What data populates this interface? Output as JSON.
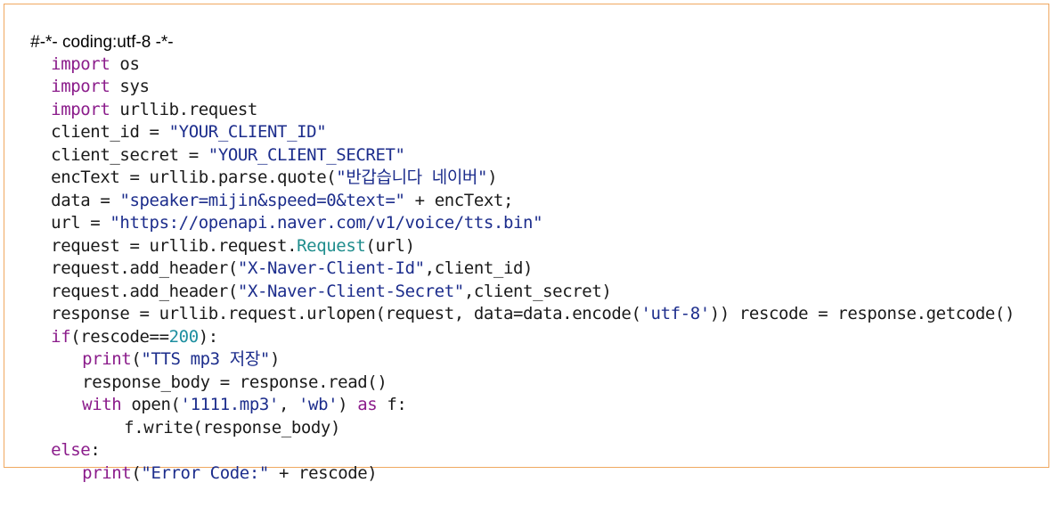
{
  "code": {
    "lines": [
      {
        "spans": [
          {
            "t": "#-*- coding:utf-8 -*-",
            "k": "pl"
          }
        ]
      },
      {
        "spans": [
          {
            "t": "import",
            "k": "kw"
          },
          {
            "t": " os",
            "k": "pl"
          }
        ]
      },
      {
        "spans": [
          {
            "t": "import",
            "k": "kw"
          },
          {
            "t": " sys",
            "k": "pl"
          }
        ]
      },
      {
        "spans": [
          {
            "t": "import",
            "k": "kw"
          },
          {
            "t": " urllib.request",
            "k": "pl"
          }
        ]
      },
      {
        "spans": [
          {
            "t": "client_id = ",
            "k": "pl"
          },
          {
            "t": "\"YOUR_CLIENT_ID\"",
            "k": "str"
          }
        ]
      },
      {
        "spans": [
          {
            "t": "client_secret = ",
            "k": "pl"
          },
          {
            "t": "\"YOUR_CLIENT_SECRET\"",
            "k": "str"
          }
        ]
      },
      {
        "spans": [
          {
            "t": "encText = urllib.parse.quote(",
            "k": "pl"
          },
          {
            "t": "\"반갑습니다 네이버\"",
            "k": "str"
          },
          {
            "t": ")",
            "k": "pl"
          }
        ]
      },
      {
        "spans": [
          {
            "t": "data = ",
            "k": "pl"
          },
          {
            "t": "\"speaker=mijin&speed=0&text=\"",
            "k": "str"
          },
          {
            "t": " + encText;",
            "k": "pl"
          }
        ]
      },
      {
        "spans": [
          {
            "t": "url = ",
            "k": "pl"
          },
          {
            "t": "\"https://openapi.naver.com/v1/voice/tts.bin\"",
            "k": "str"
          }
        ]
      },
      {
        "spans": [
          {
            "t": "request = urllib.request.",
            "k": "pl"
          },
          {
            "t": "Request",
            "k": "cls"
          },
          {
            "t": "(url)",
            "k": "pl"
          }
        ]
      },
      {
        "spans": [
          {
            "t": "request.add_header(",
            "k": "pl"
          },
          {
            "t": "\"X-Naver-Client-Id\"",
            "k": "str"
          },
          {
            "t": ",client_id)",
            "k": "pl"
          }
        ]
      },
      {
        "spans": [
          {
            "t": "request.add_header(",
            "k": "pl"
          },
          {
            "t": "\"X-Naver-Client-Secret\"",
            "k": "str"
          },
          {
            "t": ",client_secret)",
            "k": "pl"
          }
        ]
      },
      {
        "spans": [
          {
            "t": "response = urllib.request.urlopen(request, data=data.encode(",
            "k": "pl"
          },
          {
            "t": "'utf-8'",
            "k": "str"
          },
          {
            "t": ")) rescode = response.getcode()",
            "k": "pl"
          }
        ]
      },
      {
        "spans": [
          {
            "t": "if",
            "k": "kw"
          },
          {
            "t": "(rescode==",
            "k": "pl"
          },
          {
            "t": "200",
            "k": "num"
          },
          {
            "t": "):",
            "k": "pl"
          }
        ]
      },
      {
        "spans": [
          {
            "t": "print",
            "k": "kw"
          },
          {
            "t": "(",
            "k": "pl"
          },
          {
            "t": "\"TTS mp3 저장\"",
            "k": "str"
          },
          {
            "t": ")",
            "k": "pl"
          }
        ]
      },
      {
        "spans": [
          {
            "t": "response_body = response.read()",
            "k": "pl"
          }
        ]
      },
      {
        "spans": [
          {
            "t": "with",
            "k": "kw"
          },
          {
            "t": " open(",
            "k": "pl"
          },
          {
            "t": "'1111.mp3'",
            "k": "str"
          },
          {
            "t": ", ",
            "k": "pl"
          },
          {
            "t": "'wb'",
            "k": "str"
          },
          {
            "t": ") ",
            "k": "pl"
          },
          {
            "t": "as",
            "k": "kw"
          },
          {
            "t": " f:",
            "k": "pl"
          }
        ]
      },
      {
        "spans": [
          {
            "t": "f.write(response_body)",
            "k": "pl"
          }
        ]
      },
      {
        "spans": [
          {
            "t": "else",
            "k": "kw"
          },
          {
            "t": ":",
            "k": "pl"
          }
        ]
      },
      {
        "spans": [
          {
            "t": "print",
            "k": "kw"
          },
          {
            "t": "(",
            "k": "pl"
          },
          {
            "t": "\"Error Code:\"",
            "k": "str"
          },
          {
            "t": " + rescode)",
            "k": "pl"
          }
        ]
      }
    ]
  },
  "colors": {
    "border": "#f0a860",
    "keyword": "#8b1c8b",
    "string": "#1c2d8c",
    "number": "#1e8fa0",
    "class": "#1f8d8d",
    "plain": "#1a1a1a"
  }
}
